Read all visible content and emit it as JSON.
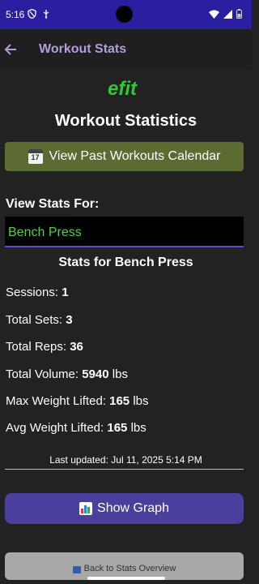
{
  "status_bar": {
    "time": "5:16"
  },
  "app_bar": {
    "title": "Workout Stats",
    "accent_color": "#b39ddb"
  },
  "logo": {
    "text": "efit",
    "color": "#35c635"
  },
  "page_title": "Workout Statistics",
  "calendar_button": {
    "icon": "calendar-icon",
    "icon_text": "17",
    "label": "View Past Workouts Calendar",
    "color": "#5c6b32"
  },
  "view_stats_label": "View Stats For:",
  "exercise_input": {
    "value": "Bench Press"
  },
  "stats_heading": "Stats for Bench Press",
  "stats": {
    "sessions_label": "Sessions:",
    "sessions_value": "1",
    "total_sets_label": "Total Sets:",
    "total_sets_value": "3",
    "total_reps_label": "Total Reps:",
    "total_reps_value": "36",
    "total_volume_label": "Total Volume:",
    "total_volume_value": "5940",
    "total_volume_unit": "lbs",
    "max_weight_label": "Max Weight Lifted:",
    "max_weight_value": "165",
    "max_weight_unit": "lbs",
    "avg_weight_label": "Avg Weight Lifted:",
    "avg_weight_value": "165",
    "avg_weight_unit": "lbs"
  },
  "last_updated": "Last updated: Jul 11, 2025 5:14 PM",
  "graph_button": {
    "icon": "bar-chart-icon",
    "label": "Show Graph",
    "color": "#4a3f9c"
  },
  "back_overview_button": {
    "icon": "back-arrow-icon",
    "label": "Back to Stats Overview"
  }
}
